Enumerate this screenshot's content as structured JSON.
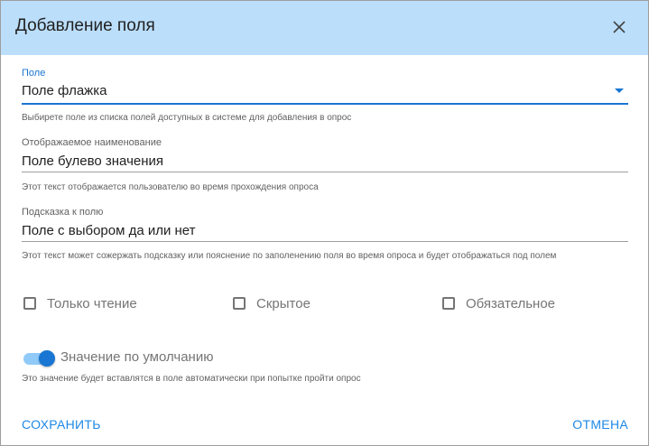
{
  "dialog": {
    "title": "Добавление поля"
  },
  "field_select": {
    "label": "Поле",
    "value": "Поле флажка",
    "hint": "Выбирете поле из списка полей доступных в системе для добавления в опрос"
  },
  "display_name": {
    "label": "Отображаемое наименование",
    "value": "Поле булево значения",
    "hint": "Этот текст отображается пользователю во время прохождения опроса"
  },
  "field_hint": {
    "label": "Подсказка к полю",
    "value": "Поле с выбором да или нет",
    "hint": "Этот текст может сожержать подсказку или пояснение по заполенению поля во время опроса и будет отображаться под полем"
  },
  "checkboxes": [
    {
      "label": "Только чтение",
      "checked": false
    },
    {
      "label": "Скрытое",
      "checked": false
    },
    {
      "label": "Обязательное",
      "checked": false
    }
  ],
  "default_value": {
    "label": "Значение по умолчанию",
    "enabled": true,
    "hint": "Это значение будет вставлятся в поле автоматически при попытке пройти опрос"
  },
  "actions": {
    "save": "СОХРАНИТЬ",
    "cancel": "ОТМЕНА"
  },
  "colors": {
    "header_bg": "#bbdefb",
    "accent": "#1976d2",
    "button_text": "#1e88e5"
  },
  "icons": {
    "close": "close-icon",
    "dropdown": "dropdown-arrow-icon"
  }
}
